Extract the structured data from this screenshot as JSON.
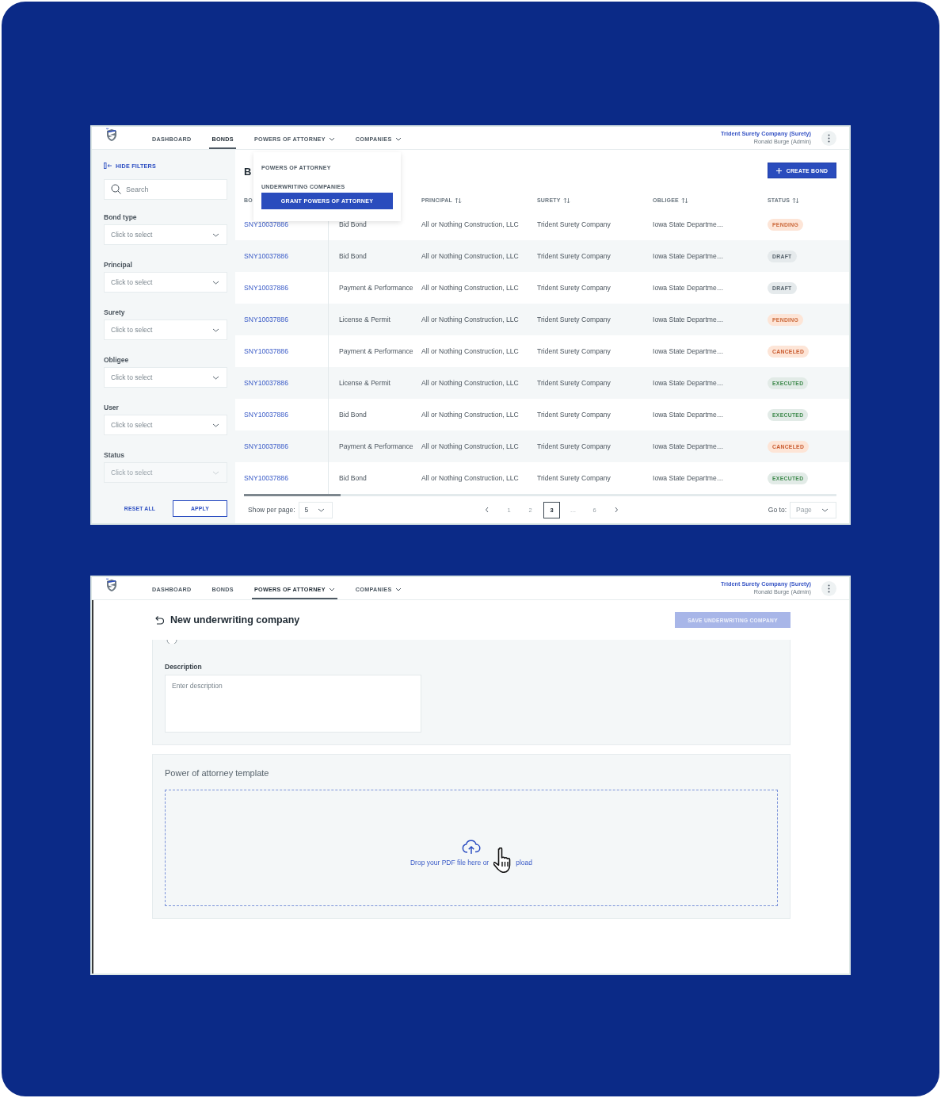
{
  "bonds_screen": {
    "nav": {
      "items": [
        {
          "label": "DASHBOARD",
          "selected": false,
          "dropdown": false
        },
        {
          "label": "BONDS",
          "selected": true,
          "dropdown": false
        },
        {
          "label": "POWERS OF ATTORNEY",
          "selected": false,
          "dropdown": true
        },
        {
          "label": "COMPANIES",
          "selected": false,
          "dropdown": true
        }
      ],
      "account": {
        "company": "Trident Surety Company (Surety)",
        "user": "Ronald Burge (Admin)"
      }
    },
    "filters": {
      "toggle": "HIDE FILTERS",
      "search": {
        "placeholder": "Search"
      },
      "fields": [
        {
          "label": "Bond type",
          "placeholder": "Click to select",
          "disabled": false
        },
        {
          "label": "Principal",
          "placeholder": "Click to select",
          "disabled": false
        },
        {
          "label": "Surety",
          "placeholder": "Click to select",
          "disabled": false
        },
        {
          "label": "Obligee",
          "placeholder": "Click to select",
          "disabled": false
        },
        {
          "label": "User",
          "placeholder": "Click to select",
          "disabled": false
        },
        {
          "label": "Status",
          "placeholder": "Click to select",
          "disabled": true
        }
      ],
      "reset": "RESET ALL",
      "apply": "APPLY"
    },
    "title": "B",
    "create_button": "CREATE BOND",
    "menu": {
      "items": [
        {
          "label": "POWERS OF ATTORNEY",
          "selected": false
        },
        {
          "label": "UNDERWRITING COMPANIES",
          "selected": false
        },
        {
          "label": "GRANT POWERS OF ATTORNEY",
          "selected": true
        }
      ]
    },
    "table": {
      "columns": [
        {
          "label": "BO"
        },
        {
          "label": "PRINCIPAL",
          "sortable": true
        },
        {
          "label": "SURETY",
          "sortable": true
        },
        {
          "label": "OBLIGEE",
          "sortable": true
        },
        {
          "label": "STATUS",
          "sortable": true
        }
      ],
      "rows": [
        {
          "bond": "SNY10037886",
          "type": "Bid Bond",
          "principal": "All or Nothing Construction, LLC",
          "surety": "Trident Surety Company",
          "obligee": "Iowa State Departme…",
          "status": {
            "label": "PENDING",
            "kind": "pending"
          }
        },
        {
          "bond": "SNY10037886",
          "type": "Bid Bond",
          "principal": "All or Nothing Construction, LLC",
          "surety": "Trident Surety Company",
          "obligee": "Iowa State Departme…",
          "status": {
            "label": "DRAFT",
            "kind": "draft"
          }
        },
        {
          "bond": "SNY10037886",
          "type": "Payment & Performance",
          "principal": "All or Nothing Construction, LLC",
          "surety": "Trident Surety Company",
          "obligee": "Iowa State Departme…",
          "status": {
            "label": "DRAFT",
            "kind": "draft"
          }
        },
        {
          "bond": "SNY10037886",
          "type": "License & Permit",
          "principal": "All or Nothing Construction, LLC",
          "surety": "Trident Surety Company",
          "obligee": "Iowa State Departme…",
          "status": {
            "label": "PENDING",
            "kind": "pending"
          }
        },
        {
          "bond": "SNY10037886",
          "type": "Payment & Performance",
          "principal": "All or Nothing Construction, LLC",
          "surety": "Trident Surety Company",
          "obligee": "Iowa State Departme…",
          "status": {
            "label": "CANCELED",
            "kind": "canceled"
          }
        },
        {
          "bond": "SNY10037886",
          "type": "License & Permit",
          "principal": "All or Nothing Construction, LLC",
          "surety": "Trident Surety Company",
          "obligee": "Iowa State Departme…",
          "status": {
            "label": "EXECUTED",
            "kind": "executed"
          }
        },
        {
          "bond": "SNY10037886",
          "type": "Bid Bond",
          "principal": "All or Nothing Construction, LLC",
          "surety": "Trident Surety Company",
          "obligee": "Iowa State Departme…",
          "status": {
            "label": "EXECUTED",
            "kind": "executed"
          }
        },
        {
          "bond": "SNY10037886",
          "type": "Payment & Performance",
          "principal": "All or Nothing Construction, LLC",
          "surety": "Trident Surety Company",
          "obligee": "Iowa State Departme…",
          "status": {
            "label": "CANCELED",
            "kind": "canceled"
          }
        },
        {
          "bond": "SNY10037886",
          "type": "Bid Bond",
          "principal": "All or Nothing Construction, LLC",
          "surety": "Trident Surety Company",
          "obligee": "Iowa State Departme…",
          "status": {
            "label": "EXECUTED",
            "kind": "executed"
          }
        }
      ]
    },
    "footer": {
      "per_page_label": "Show per page:",
      "per_page": "5",
      "pages": [
        {
          "label": "1",
          "selected": false
        },
        {
          "label": "2",
          "selected": false
        },
        {
          "label": "3",
          "selected": true
        },
        {
          "label": "…",
          "selected": false
        },
        {
          "label": "6",
          "selected": false
        }
      ],
      "goto_label": "Go to:",
      "goto_placeholder": "Page"
    }
  },
  "underwriting_screen": {
    "nav": {
      "items": [
        {
          "label": "DASHBOARD",
          "selected": false,
          "dropdown": false
        },
        {
          "label": "BONDS",
          "selected": false,
          "dropdown": false
        },
        {
          "label": "POWERS OF ATTORNEY",
          "selected": true,
          "dropdown": true
        },
        {
          "label": "COMPANIES",
          "selected": false,
          "dropdown": true
        }
      ],
      "account": {
        "company": "Trident Surety Company (Surety)",
        "user": "Ronald Burge (Admin)"
      }
    },
    "title": "New underwriting company",
    "save_button": {
      "label": "SAVE UNDERWRITING COMPANY",
      "disabled": true
    },
    "description": {
      "label": "Description",
      "placeholder": "Enter description"
    },
    "template": {
      "title": "Power of attorney template",
      "drop_text_start": "Drop your PDF file here or",
      "drop_text_end": "pload"
    }
  }
}
